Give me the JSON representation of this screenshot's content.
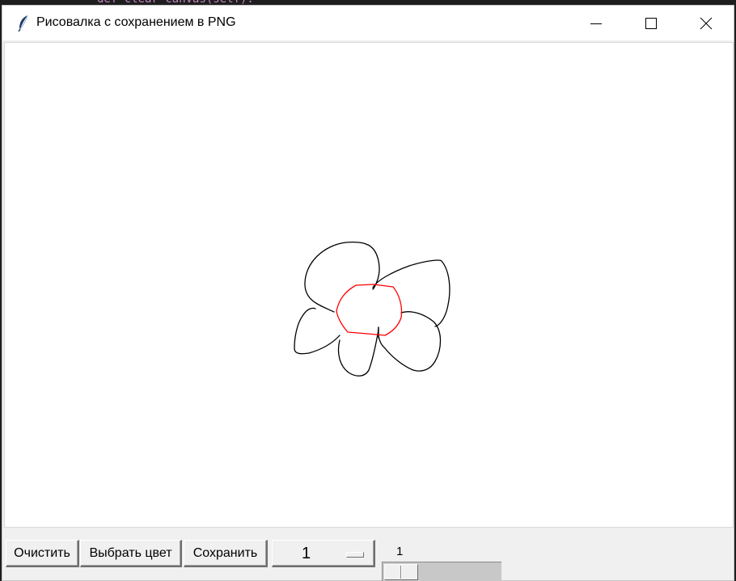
{
  "window": {
    "title": "Рисовалка с сохранением в PNG",
    "app_icon": "feather-icon",
    "controls": {
      "minimize": "minimize-icon",
      "maximize": "maximize-icon",
      "close": "close-icon"
    }
  },
  "canvas": {
    "background": "#ffffff",
    "stroke_colors": [
      "#000000",
      "#ff0000"
    ]
  },
  "toolbar": {
    "clear_label": "Очистить",
    "color_label": "Выбрать цвет",
    "save_label": "Сохранить",
    "brush_size_selected": "1",
    "scale_value": "1"
  }
}
